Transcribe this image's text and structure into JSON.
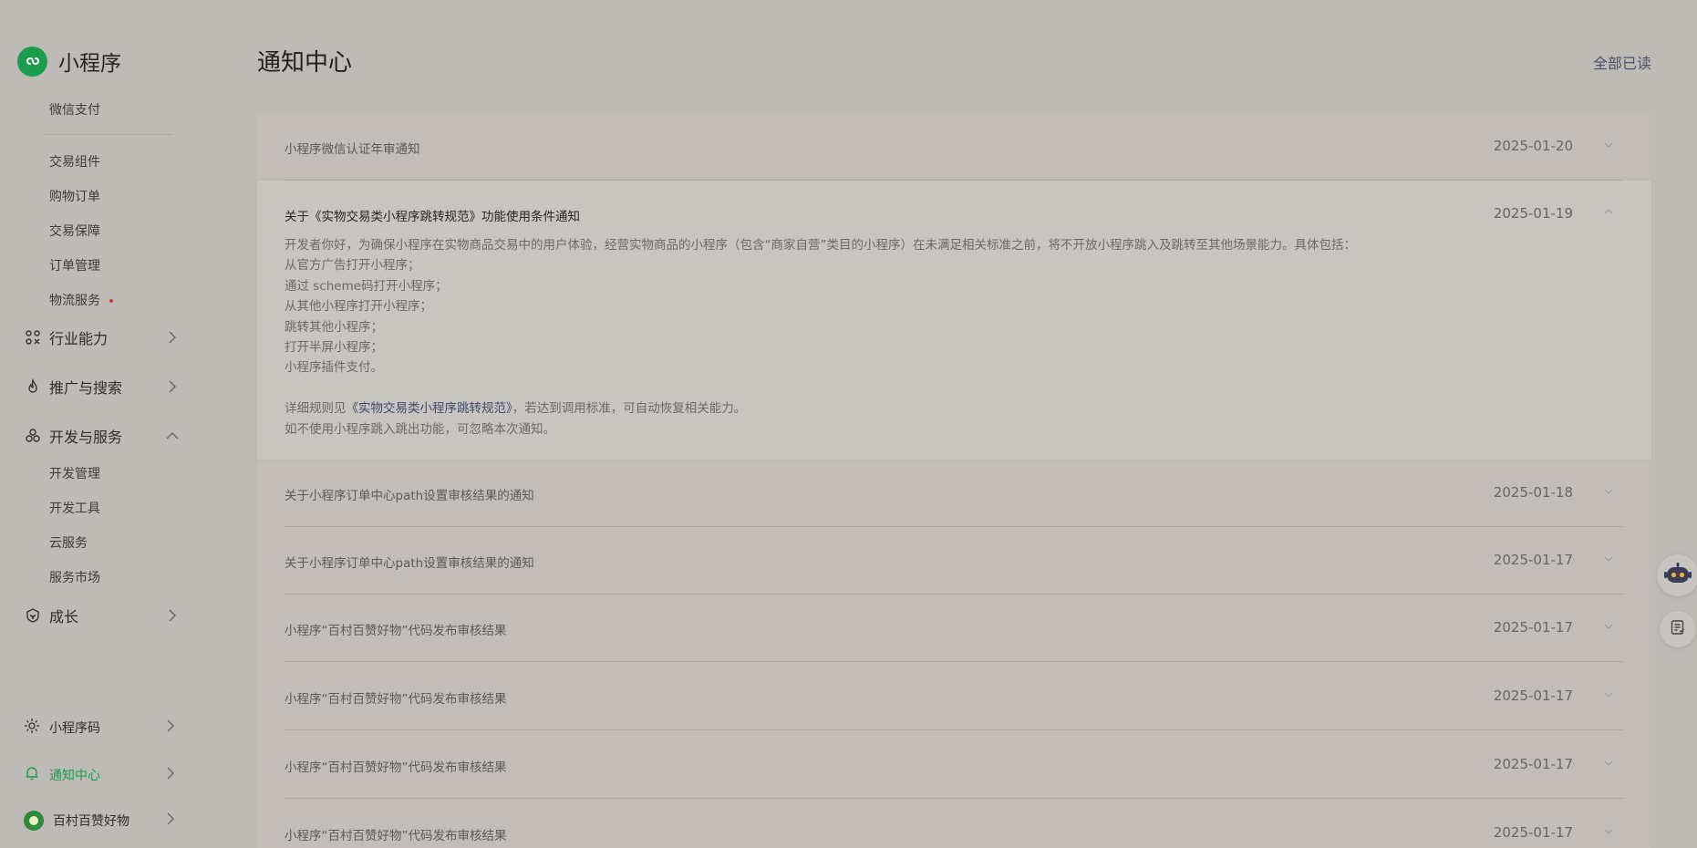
{
  "app": {
    "name": "小程序",
    "brand_color": "#1b9d4e"
  },
  "sidebar": {
    "top_items": [
      "微信支付"
    ],
    "trade_items": [
      "交易组件",
      "购物订单",
      "交易保障",
      "订单管理",
      "物流服务"
    ],
    "groups": {
      "industry": "行业能力",
      "promotion": "推广与搜索",
      "dev": "开发与服务",
      "growth": "成长"
    },
    "dev_items": [
      "开发管理",
      "开发工具",
      "云服务",
      "服务市场"
    ],
    "bottom": {
      "qrcode": "小程序码",
      "notify": "通知中心",
      "account": "百村百赞好物"
    }
  },
  "header": {
    "title": "通知中心",
    "mark_all_read": "全部已读"
  },
  "notifications": [
    {
      "title": "小程序微信认证年审通知",
      "date": "2025-01-20"
    },
    {
      "title": "关于《实物交易类小程序跳转规范》功能使用条件通知",
      "date": "2025-01-19"
    },
    {
      "title": "关于小程序订单中心path设置审核结果的通知",
      "date": "2025-01-18"
    },
    {
      "title": "关于小程序订单中心path设置审核结果的通知",
      "date": "2025-01-17"
    },
    {
      "title": "小程序“百村百赞好物”代码发布审核结果",
      "date": "2025-01-17"
    },
    {
      "title": "小程序“百村百赞好物”代码发布审核结果",
      "date": "2025-01-17"
    },
    {
      "title": "小程序“百村百赞好物”代码发布审核结果",
      "date": "2025-01-17"
    },
    {
      "title": "小程序“百村百赞好物”代码发布审核结果",
      "date": "2025-01-17"
    }
  ],
  "expanded_content": {
    "intro": "开发者你好，为确保小程序在实物商品交易中的用户体验，经营实物商品的小程序（包含“商家自营”类目的小程序）在未满足相关标准之前，将不开放小程序跳入及跳转至其他场景能力。具体包括：",
    "items": [
      "从官方广告打开小程序；",
      "通过 scheme码打开小程序；",
      "从其他小程序打开小程序；",
      "跳转其他小程序；",
      "打开半屏小程序；",
      "小程序插件支付。"
    ],
    "rule_prefix": "详细规则见",
    "rule_link": "《实物交易类小程序跳转规范》",
    "rule_suffix": "，若达到调用标准，可自动恢复相关能力。",
    "ignore_note": "如不使用小程序跳入跳出功能，可忽略本次通知。"
  }
}
